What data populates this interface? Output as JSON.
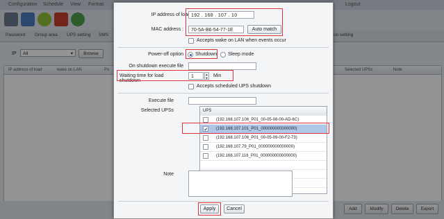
{
  "background": {
    "menu": [
      "Configuration",
      "Schedule",
      "View",
      "Format",
      "Logout"
    ],
    "tabs": [
      "Password",
      "Group area",
      "UPS setting",
      "SMS",
      "on setting"
    ],
    "filter": {
      "label": "IP",
      "value": "All",
      "browse": "Browse"
    },
    "columns": [
      "IP address of load",
      "wake on LAN",
      "Po",
      "Selected UPSs",
      "Note"
    ],
    "bottom_buttons": [
      "Add",
      "Modify",
      "Delete",
      "Export"
    ]
  },
  "dialog": {
    "ip": {
      "label": "IP address of load",
      "octets": [
        "192",
        "168",
        "107",
        "10"
      ]
    },
    "mac": {
      "label": "MAC address :",
      "value": "70-5A-B6-54-77-1E",
      "auto_match": "Auto match"
    },
    "wake_lan": "Accepts wake on LAN when events occur",
    "power_off": {
      "label": "Power-off option",
      "shutdown": "Shutdown",
      "sleep": "Sleep mode",
      "selected": "shutdown"
    },
    "shutdown_exec": {
      "label": "On shutdown execute file",
      "value": ""
    },
    "waiting": {
      "label": "Waiting time for load shutdown",
      "value": "1",
      "unit": "Min"
    },
    "accept_sched": "Accepts scheduled UPS shutdown",
    "execute_file": {
      "label": "Execute file",
      "value": ""
    },
    "selected_upss": {
      "label": "Selected UPSs",
      "header": "UPS",
      "items": [
        {
          "text": "(192.168.107.106_P01_00-05-08-00-AD-6C)",
          "checked": false
        },
        {
          "text": "(192.168.107.101_P01_000000000000000)",
          "checked": true
        },
        {
          "text": "(192.168.107.106_P01_00-05-09-00-F2-73)",
          "checked": false
        },
        {
          "text": "(192.168.107.79_P01_000000000000000)",
          "checked": false
        },
        {
          "text": "(192.168.107.116_P01_000000000000000)",
          "checked": false
        }
      ]
    },
    "note": {
      "label": "Note",
      "value": ""
    },
    "apply": "Apply",
    "cancel": "Cancel"
  },
  "colors": {
    "highlight": "#e0303a",
    "selection": "#aec7e8"
  }
}
